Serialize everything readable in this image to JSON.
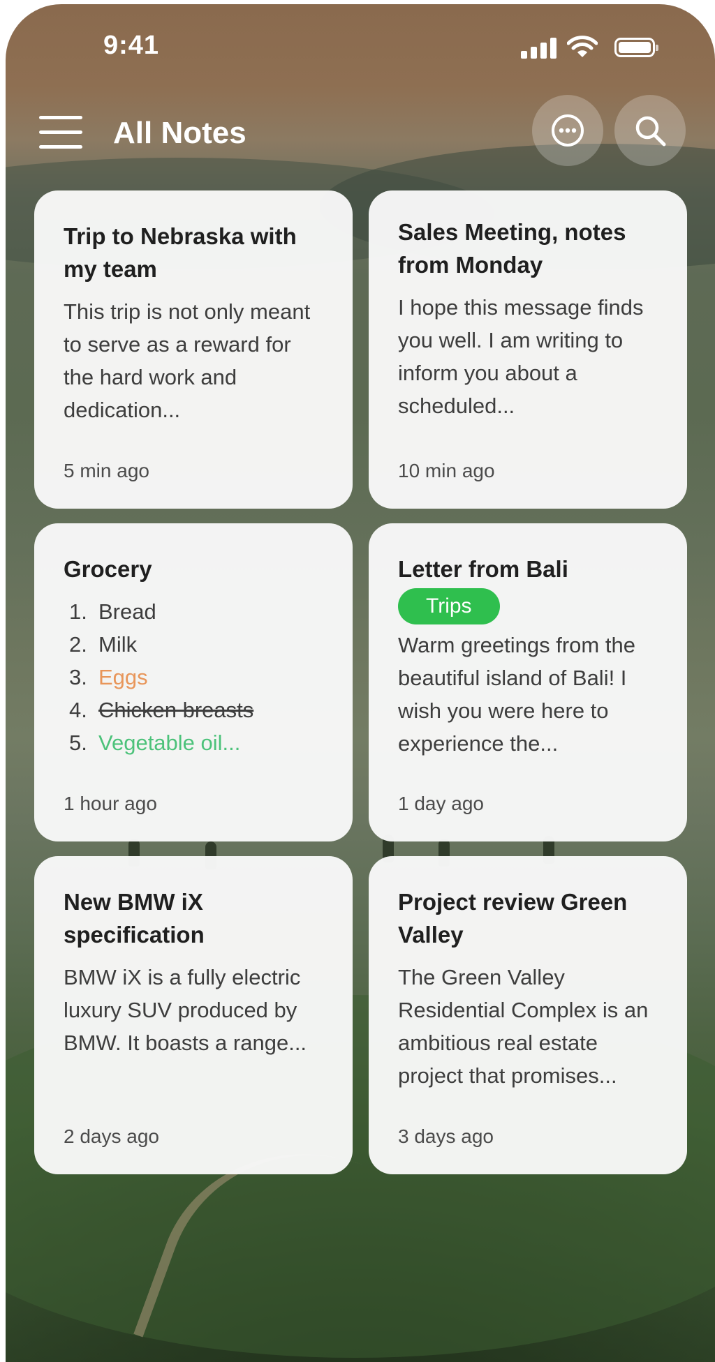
{
  "status_bar": {
    "time": "9:41"
  },
  "header": {
    "title": "All Notes",
    "menu_icon": "hamburger-icon",
    "more_icon": "more-dots-icon",
    "search_icon": "search-icon"
  },
  "notes": [
    {
      "title": "Trip to Nebraska with my team",
      "body": "This trip is not only meant to serve as a reward for the hard work and dedication...",
      "time": "5 min ago"
    },
    {
      "title": "Sales Meeting, notes from Monday",
      "body": "I hope this message finds you well. I am writing to inform you about a scheduled...",
      "time": "10 min ago"
    },
    {
      "title": "Grocery",
      "list": [
        {
          "num": "1.",
          "text": "Bread",
          "style": "normal"
        },
        {
          "num": "2.",
          "text": "Milk",
          "style": "normal"
        },
        {
          "num": "3.",
          "text": "Eggs",
          "style": "highlight"
        },
        {
          "num": "4.",
          "text": "Chicken breasts",
          "style": "strike"
        },
        {
          "num": "5.",
          "text": "Vegetable oil...",
          "style": "done"
        }
      ],
      "time": "1 hour ago"
    },
    {
      "title": "Letter from Bali",
      "tag": "Trips",
      "body": "Warm greetings from the beautiful island of Bali! I wish you were here to experience the...",
      "time": "1 day ago"
    },
    {
      "title": "New BMW iX specification",
      "body": "BMW iX is a fully electric luxury SUV produced by BMW. It boasts a range...",
      "time": "2 days ago"
    },
    {
      "title": "Project review Green Valley",
      "body": "The Green Valley Residential Complex is an ambitious real estate project that promises...",
      "time": "3 days ago"
    }
  ],
  "colors": {
    "tag_green": "#2fbf4e",
    "eggs_orange": "#e8965a",
    "done_green": "#4cc27a",
    "card_bg": "#f8f8f8"
  }
}
